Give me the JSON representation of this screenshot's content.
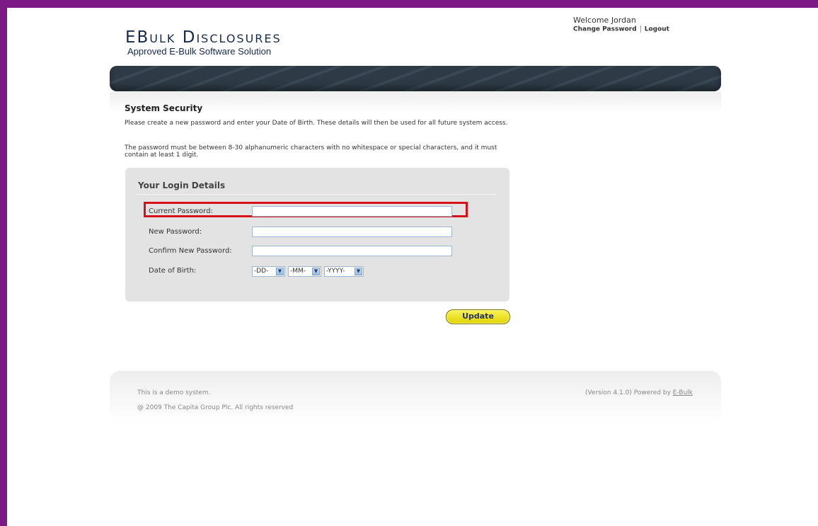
{
  "header": {
    "brand": "EBulk Disclosures",
    "tagline": "Approved E-Bulk Software Solution",
    "welcome": "Welcome Jordan",
    "links": [
      "Change Password",
      "Logout"
    ]
  },
  "main": {
    "title": "System Security",
    "paragraph1": "Please create a new password and enter your Date of Birth. These details will then be used for all future system access.",
    "paragraph2": "The password must be between 8-30 alphanumeric characters with no whitespace or special characters, and it must contain at least 1 digit.",
    "form": {
      "title": "Your Login Details",
      "fields": [
        {
          "label": "Current Password:",
          "value": ""
        },
        {
          "label": "New Password:",
          "value": ""
        },
        {
          "label": "Confirm New Password:",
          "value": ""
        }
      ],
      "dob_label": "Date of Birth:",
      "dob_day": "-DD-",
      "dob_month": "-MM-",
      "dob_year": "-YYYY-",
      "submit": "Update"
    }
  },
  "footer": {
    "note": "This is a demo system.",
    "copyright": "@ 2009 The Capita Group Plc. All rights reserved",
    "version": "(Version 4.1.0) Powered by",
    "powered_link": "E-Bulk"
  },
  "colors": {
    "frame": "#7b1a84",
    "brand": "#16294d",
    "highlight": "#d6111b",
    "button": "#f3e817"
  }
}
